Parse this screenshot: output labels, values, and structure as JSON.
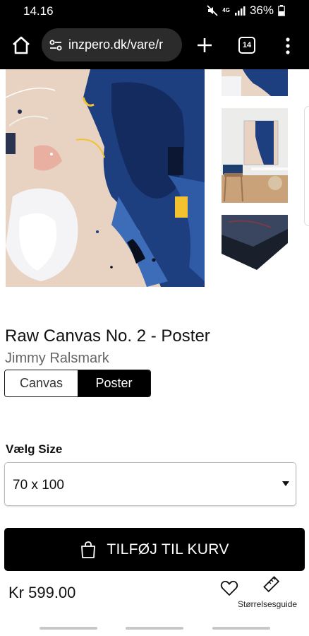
{
  "status_bar": {
    "time": "14.16",
    "network": "4G",
    "battery": "36%"
  },
  "browser": {
    "url": "inzpero.dk/vare/r",
    "tab_count": "14"
  },
  "product": {
    "title": "Raw Canvas No. 2 - Poster",
    "artist": "Jimmy Ralsmark",
    "formats": [
      "Canvas",
      "Poster"
    ],
    "selected_format": "Poster",
    "size_label": "Vælg Size",
    "selected_size": "70 x 100",
    "add_to_cart_label": "TILFØJ TIL KURV",
    "price": "Kr 599.00",
    "size_guide_label": "Størrelsesguide"
  },
  "colors": {
    "accent": "#000000",
    "artwork_blue": "#1d3f80",
    "artwork_peach": "#e8d2c2"
  },
  "icons": [
    "home-icon",
    "tune-icon",
    "plus-icon",
    "tabs-icon",
    "more-vert-icon",
    "shopping-bag-icon",
    "heart-icon",
    "ruler-icon"
  ]
}
